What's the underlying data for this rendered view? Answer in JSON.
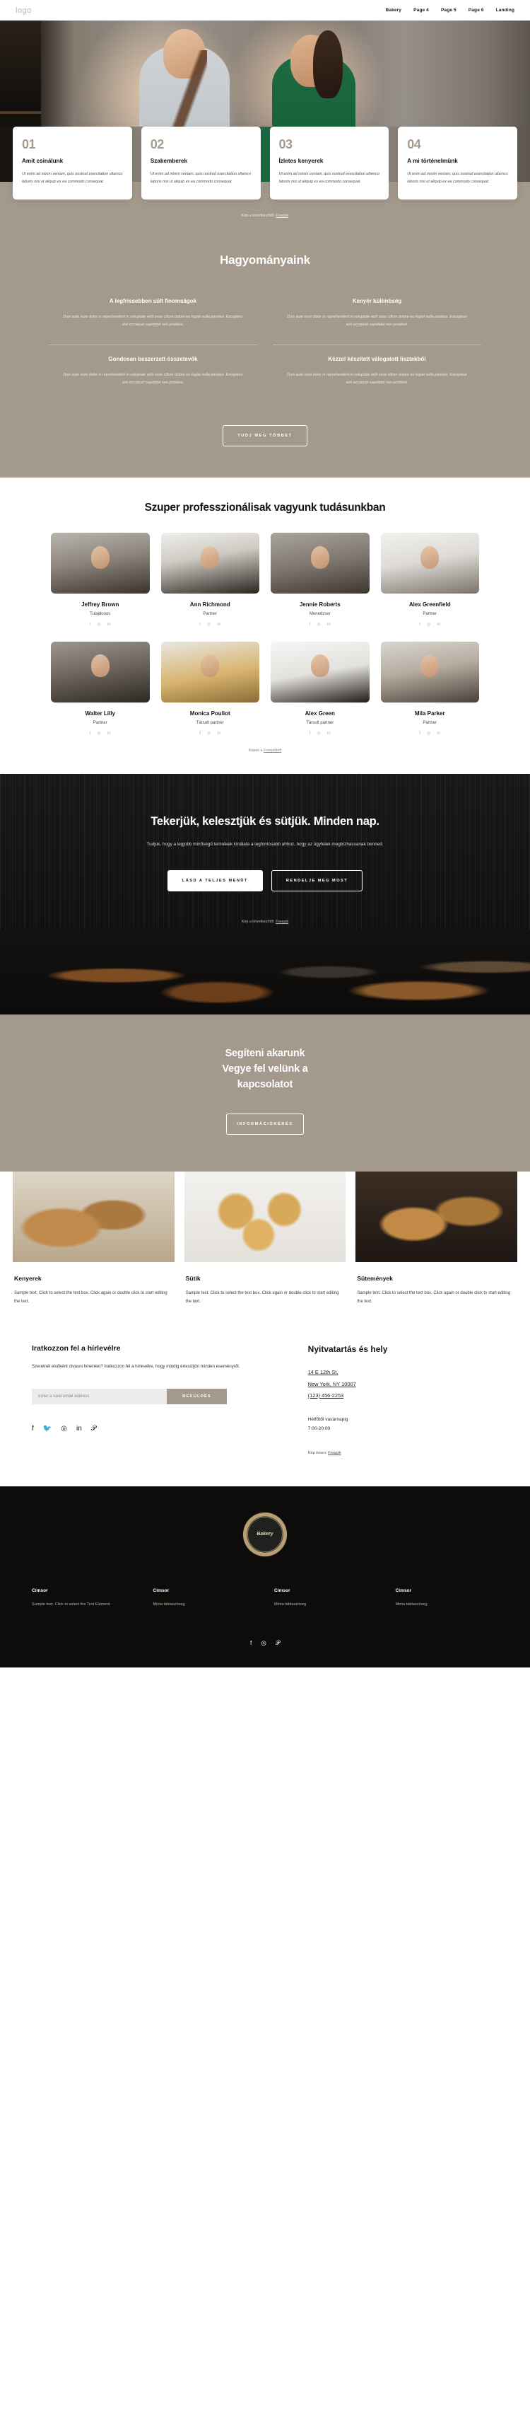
{
  "header": {
    "logo": "logo",
    "nav": [
      {
        "label": "Bakery"
      },
      {
        "label": "Page 4"
      },
      {
        "label": "Page 5"
      },
      {
        "label": "Page 6"
      },
      {
        "label": "Landing"
      }
    ]
  },
  "feature_cards": [
    {
      "num": "01",
      "title": "Amit csinálunk",
      "text": "Ut enim ad minim veniam, quis nostrud exercitation ullamco laboris nisi ut aliquip ex ea commodo consequat."
    },
    {
      "num": "02",
      "title": "Szakemberek",
      "text": "Ut enim ad minim veniam, quis nostrud exercitation ullamco laboris nisi ut aliquip ex ea commodo consequat."
    },
    {
      "num": "03",
      "title": "Ízletes kenyerek",
      "text": "Ut enim ad minim veniam, quis nostrud exercitation ullamco laboris nisi ut aliquip ex ea commodo consequat."
    },
    {
      "num": "04",
      "title": "A mi történelmünk",
      "text": "Ut enim ad minim veniam, quis nostrud exercitation ullamco laboris nisi ut aliquip ex ea commodo consequat."
    }
  ],
  "hero_credit": {
    "prefix": "Kép a következőtől: ",
    "link": "Freepik"
  },
  "traditions": {
    "title": "Hagyományaink",
    "items": [
      {
        "heading": "A legfrissebben sült finomságok",
        "text": "Duis aute irure dolor in reprehenderit in voluptate velit esse cillum dolore eu fugiat nulla pariatur. Excepteur sint occaecat cupidatat non proident."
      },
      {
        "heading": "Kenyér különbség",
        "text": "Duis aute irure dolor in reprehenderit in voluptate velit esse cillum dolore eu fugiat nulla pariatur. Excepteur sint occaecat cupidatat non proident."
      },
      {
        "heading": "Gondosan beszerzett összetevők",
        "text": "Duis aute irure dolor in reprehenderit in voluptate velit esse cillum dolore eu fugiat nulla pariatur. Excepteur sint occaecat cupidatat non proident."
      },
      {
        "heading": "Kézzel készített válogatott lisztekből",
        "text": "Duis aute irure dolor in reprehenderit in voluptate velit esse cillum dolore eu fugiat nulla pariatur. Excepteur sint occaecat cupidatat non proident."
      }
    ],
    "button": "TUDJ MEG TÖBBET"
  },
  "team": {
    "title": "Szuper professzionálisak vagyunk tudásunkban",
    "members": [
      {
        "name": "Jeffrey Brown",
        "role": "Tulajdonos"
      },
      {
        "name": "Ann Richmond",
        "role": "Partner"
      },
      {
        "name": "Jennie Roberts",
        "role": "Menedzser"
      },
      {
        "name": "Alex Greenfield",
        "role": "Partner"
      },
      {
        "name": "Walter Lilly",
        "role": "Partner"
      },
      {
        "name": "Monica Pouliot",
        "role": "Társult partner"
      },
      {
        "name": "Alex Green",
        "role": "Társult partner"
      },
      {
        "name": "Mila Parker",
        "role": "Partner"
      }
    ],
    "social": {
      "facebook": "f",
      "instagram": "◎",
      "linkedin": "in"
    },
    "credit": {
      "prefix": "Képek a ",
      "link": "Freepikből"
    }
  },
  "cta": {
    "heading": "Tekerjük, kelesztjük és sütjük. Minden nap.",
    "text": "Tudjuk, hogy a legjobb minőségű termékek kínálata a legfontosabb ahhoz, hogy az ügyfelek megbízhassanak benned.",
    "primary_button": "LÁSD A TELJES MENÜT",
    "secondary_button": "RENDELJE MEG MOST",
    "credit": {
      "prefix": "Kép a következőtől: ",
      "link": "Freepik"
    }
  },
  "contact": {
    "heading_line1": "Segíteni akarunk",
    "heading_line2": "Vegye fel velünk a",
    "heading_line3": "kapcsolatot",
    "button": "INFORMÁCIÓKÉRÉS"
  },
  "products": [
    {
      "name": "Kenyerek",
      "text": "Sample text. Click to select the text box. Click again or double click to start editing the text."
    },
    {
      "name": "Sütik",
      "text": "Sample text. Click to select the text box. Click again or double click to start editing the text."
    },
    {
      "name": "Sütemények",
      "text": "Sample text. Click to select the text box. Click again or double click to start editing the text."
    }
  ],
  "newsletter": {
    "heading": "Iratkozzon fel a hírlevélre",
    "text": "Szeretnél elsőként olvasni híreinket? Iratkozzon fel a hírlevélre, hogy mindig értesüljön minden eseményről.",
    "placeholder": "Enter a valid email address",
    "value": "",
    "button": "BEKÜLDÉS",
    "social": [
      "f",
      "🐦",
      "◎",
      "in",
      "𝒫"
    ]
  },
  "hours": {
    "heading": "Nyitvatartás és hely",
    "address_line1": "14 E 12th St,",
    "address_line2": "New York, NY 10007",
    "phone": "(123) 456-2253",
    "days": "Hétfőtől vasárnapig",
    "time": "7:00-20:00",
    "credit": {
      "prefix": "Kép innen: ",
      "link": "Freepik"
    }
  },
  "bottom": {
    "seal": "Bakery",
    "columns": [
      {
        "heading": "Címsor",
        "text": "Sample text. Click to select the Text Element."
      },
      {
        "heading": "Címsor",
        "text": "Minta táblaszöveg"
      },
      {
        "heading": "Címsor",
        "text": "Minta táblaszöveg"
      },
      {
        "heading": "Címsor",
        "text": "Minta táblaszöveg"
      }
    ],
    "social": [
      "f",
      "◎",
      "𝒫"
    ]
  },
  "colors": {
    "accent": "#a3998c",
    "dark": "#151313",
    "text": "#141414"
  }
}
